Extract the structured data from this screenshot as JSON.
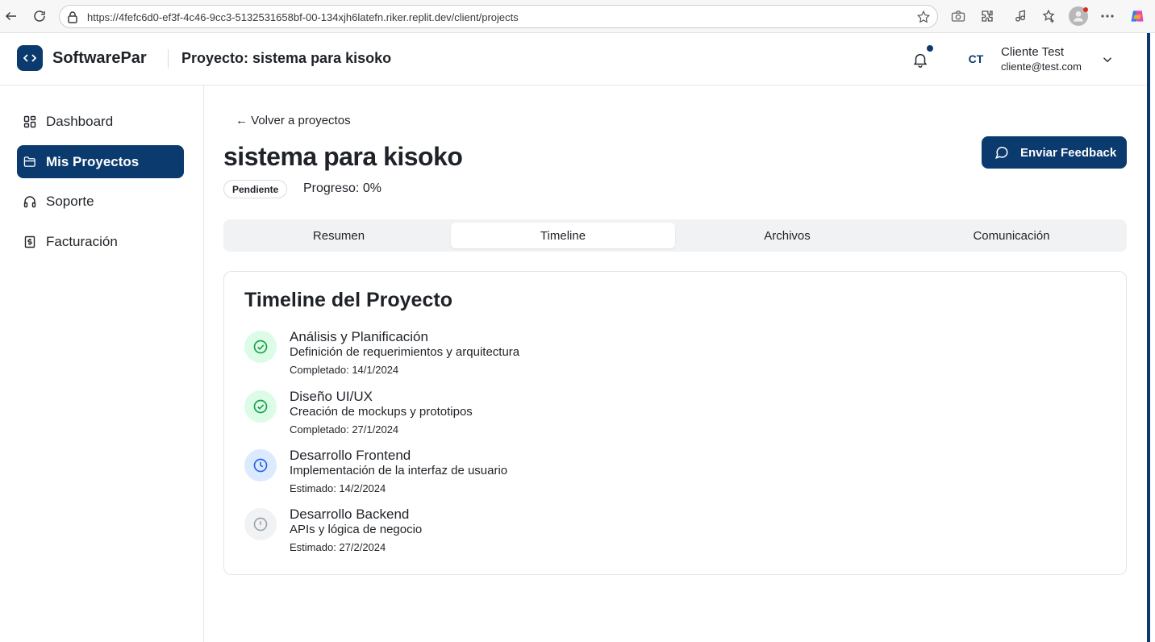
{
  "browser": {
    "url": "https://4fefc6d0-ef3f-4c46-9cc3-5132531658bf-00-134xjh6latefn.riker.replit.dev/client/projects"
  },
  "header": {
    "brand": "SoftwarePar",
    "title": "Proyecto: sistema para kisoko",
    "avatar_initials": "CT",
    "user_name": "Cliente Test",
    "user_email": "cliente@test.com",
    "accent_color": "#0b3a6e"
  },
  "sidebar": {
    "items": [
      {
        "label": "Dashboard",
        "icon": "dashboard-icon",
        "active": false
      },
      {
        "label": "Mis Proyectos",
        "icon": "folder-icon",
        "active": true
      },
      {
        "label": "Soporte",
        "icon": "headphones-icon",
        "active": false
      },
      {
        "label": "Facturación",
        "icon": "invoice-icon",
        "active": false
      }
    ]
  },
  "main": {
    "back_link": "← Volver a proyectos",
    "project_title": "sistema para kisoko",
    "status": "Pendiente",
    "progress": "Progreso: 0%",
    "progress_value": 0,
    "feedback_button": "Enviar Feedback",
    "tabs": [
      {
        "label": "Resumen",
        "active": false
      },
      {
        "label": "Timeline",
        "active": true
      },
      {
        "label": "Archivos",
        "active": false
      },
      {
        "label": "Comunicación",
        "active": false
      }
    ],
    "timeline": {
      "title": "Timeline del Proyecto",
      "items": [
        {
          "name": "Análisis y Planificación",
          "description": "Definición de requerimientos y arquitectura",
          "date": "Completado: 14/1/2024",
          "state": "completed",
          "icon": "check-circle-icon",
          "color": "#16a34a"
        },
        {
          "name": "Diseño UI/UX",
          "description": "Creación de mockups y prototipos",
          "date": "Completado: 27/1/2024",
          "state": "completed",
          "icon": "check-circle-icon",
          "color": "#16a34a"
        },
        {
          "name": "Desarrollo Frontend",
          "description": "Implementación de la interfaz de usuario",
          "date": "Estimado: 14/2/2024",
          "state": "in-progress",
          "icon": "clock-icon",
          "color": "#2563eb"
        },
        {
          "name": "Desarrollo Backend",
          "description": "APIs y lógica de negocio",
          "date": "Estimado: 27/2/2024",
          "state": "pending",
          "icon": "alert-circle-icon",
          "color": "#9ca3af"
        }
      ]
    }
  }
}
